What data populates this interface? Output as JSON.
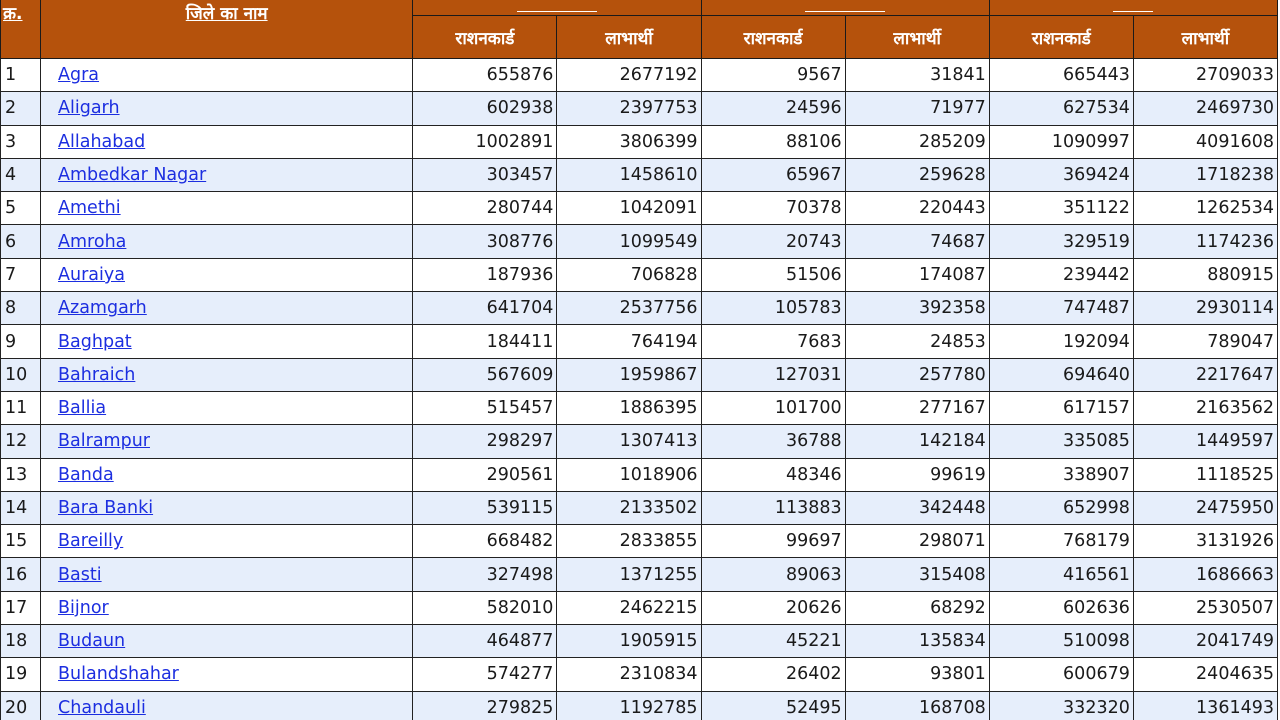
{
  "header": {
    "sn_label": "क्र.",
    "district_label": "जिले का नाम",
    "groups": [
      "",
      "",
      ""
    ],
    "sub_labels": [
      "राशनकार्ड",
      "लाभार्थी",
      "राशनकार्ड",
      "लाभार्थी",
      "राशनकार्ड",
      "लाभार्थी"
    ]
  },
  "rows": [
    {
      "sn": "1",
      "district": "Agra",
      "values": [
        "655876",
        "2677192",
        "9567",
        "31841",
        "665443",
        "2709033"
      ]
    },
    {
      "sn": "2",
      "district": "Aligarh",
      "values": [
        "602938",
        "2397753",
        "24596",
        "71977",
        "627534",
        "2469730"
      ]
    },
    {
      "sn": "3",
      "district": "Allahabad",
      "values": [
        "1002891",
        "3806399",
        "88106",
        "285209",
        "1090997",
        "4091608"
      ]
    },
    {
      "sn": "4",
      "district": "Ambedkar Nagar",
      "values": [
        "303457",
        "1458610",
        "65967",
        "259628",
        "369424",
        "1718238"
      ]
    },
    {
      "sn": "5",
      "district": "Amethi",
      "values": [
        "280744",
        "1042091",
        "70378",
        "220443",
        "351122",
        "1262534"
      ]
    },
    {
      "sn": "6",
      "district": "Amroha",
      "values": [
        "308776",
        "1099549",
        "20743",
        "74687",
        "329519",
        "1174236"
      ]
    },
    {
      "sn": "7",
      "district": "Auraiya",
      "values": [
        "187936",
        "706828",
        "51506",
        "174087",
        "239442",
        "880915"
      ]
    },
    {
      "sn": "8",
      "district": "Azamgarh",
      "values": [
        "641704",
        "2537756",
        "105783",
        "392358",
        "747487",
        "2930114"
      ]
    },
    {
      "sn": "9",
      "district": "Baghpat",
      "values": [
        "184411",
        "764194",
        "7683",
        "24853",
        "192094",
        "789047"
      ]
    },
    {
      "sn": "10",
      "district": "Bahraich",
      "values": [
        "567609",
        "1959867",
        "127031",
        "257780",
        "694640",
        "2217647"
      ]
    },
    {
      "sn": "11",
      "district": "Ballia",
      "values": [
        "515457",
        "1886395",
        "101700",
        "277167",
        "617157",
        "2163562"
      ]
    },
    {
      "sn": "12",
      "district": "Balrampur",
      "values": [
        "298297",
        "1307413",
        "36788",
        "142184",
        "335085",
        "1449597"
      ]
    },
    {
      "sn": "13",
      "district": "Banda",
      "values": [
        "290561",
        "1018906",
        "48346",
        "99619",
        "338907",
        "1118525"
      ]
    },
    {
      "sn": "14",
      "district": "Bara Banki",
      "values": [
        "539115",
        "2133502",
        "113883",
        "342448",
        "652998",
        "2475950"
      ]
    },
    {
      "sn": "15",
      "district": "Bareilly",
      "values": [
        "668482",
        "2833855",
        "99697",
        "298071",
        "768179",
        "3131926"
      ]
    },
    {
      "sn": "16",
      "district": "Basti",
      "values": [
        "327498",
        "1371255",
        "89063",
        "315408",
        "416561",
        "1686663"
      ]
    },
    {
      "sn": "17",
      "district": "Bijnor",
      "values": [
        "582010",
        "2462215",
        "20626",
        "68292",
        "602636",
        "2530507"
      ]
    },
    {
      "sn": "18",
      "district": "Budaun",
      "values": [
        "464877",
        "1905915",
        "45221",
        "135834",
        "510098",
        "2041749"
      ]
    },
    {
      "sn": "19",
      "district": "Bulandshahar",
      "values": [
        "574277",
        "2310834",
        "26402",
        "93801",
        "600679",
        "2404635"
      ]
    },
    {
      "sn": "20",
      "district": "Chandauli",
      "values": [
        "279825",
        "1192785",
        "52495",
        "168708",
        "332320",
        "1361493"
      ]
    }
  ],
  "colors": {
    "header_bg": "#b5520c",
    "row_alt_bg": "#e6eefb",
    "link": "#1c2ee0"
  }
}
